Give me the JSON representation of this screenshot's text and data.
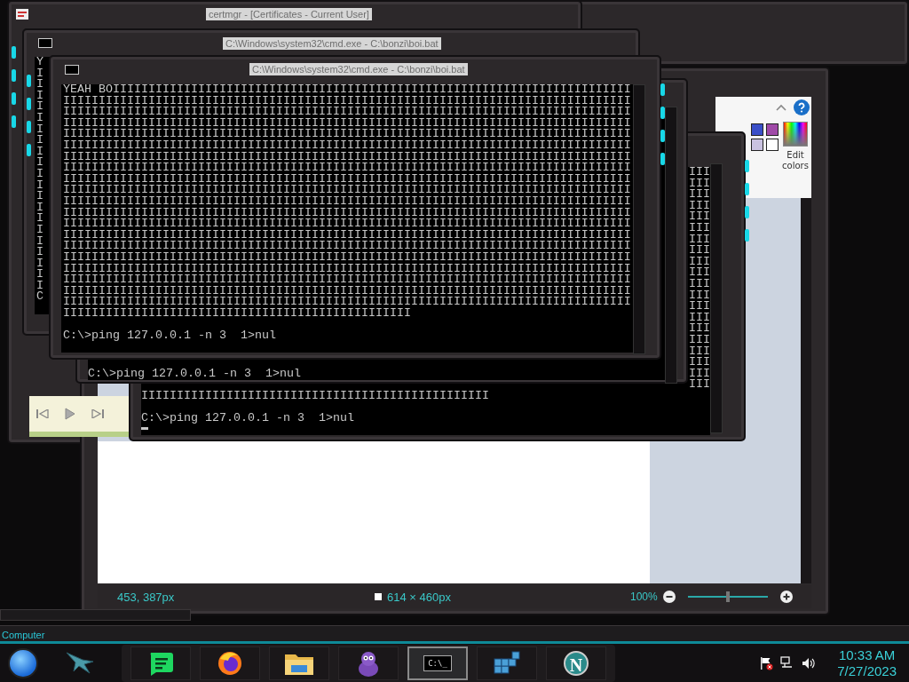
{
  "certmgr_window": {
    "title": "certmgr - [Certificates - Current User]"
  },
  "paint_window": {
    "palette": [
      {
        "color": "#3a4fc8"
      },
      {
        "color": "#a04aa8"
      },
      {
        "color": "#c9c2e0"
      },
      {
        "color": "#ffffff"
      }
    ],
    "edit_colors": "Edit colors",
    "cursor_position": "453, 387px",
    "canvas_size": "614 × 460px",
    "zoom": "100%",
    "zoom_slider": {
      "level": 0.5
    }
  },
  "cmd_windows": [
    {
      "title": "C:\\Windows\\system32\\cmd.exe - C:\\bonzi\\boi.bat",
      "lines": [
        "Y",
        "I",
        "I",
        "I",
        "I",
        "I",
        "I",
        "I",
        "I",
        "I",
        "I",
        "I",
        "I",
        "I",
        "I",
        "I",
        "I",
        "I",
        "I",
        "I",
        "I",
        "C"
      ]
    },
    {
      "prompt": "C:\\>ping 127.0.0.1 -n 3  1>nul"
    },
    {
      "right_lines": [
        "III",
        "III",
        "III",
        "III",
        "III",
        "III",
        "III",
        "III",
        "III",
        "III",
        "III",
        "III",
        "III",
        "III",
        "III",
        "III",
        "III",
        "III",
        "III",
        "III"
      ],
      "lines": [
        "IIIIIIIIIIIIIIIIIIIIIIIIIIIIIIIIIIIIIIIIIIIIIIIII"
      ],
      "prompt": "C:\\>ping 127.0.0.1 -n 3  1>nul"
    },
    {
      "title": "C:\\Windows\\system32\\cmd.exe - C:\\bonzi\\boi.bat",
      "lines": [
        "YEAH BOIIIIIIIIIIIIIIIIIIIIIIIIIIIIIIIIIIIIIIIIIIIIIIIIIIIIIIIIIIIIIIIIIIIIIIIII",
        "IIIIIIIIIIIIIIIIIIIIIIIIIIIIIIIIIIIIIIIIIIIIIIIIIIIIIIIIIIIIIIIIIIIIIIIIIIIIIIII",
        "IIIIIIIIIIIIIIIIIIIIIIIIIIIIIIIIIIIIIIIIIIIIIIIIIIIIIIIIIIIIIIIIIIIIIIIIIIIIIIII",
        "IIIIIIIIIIIIIIIIIIIIIIIIIIIIIIIIIIIIIIIIIIIIIIIIIIIIIIIIIIIIIIIIIIIIIIIIIIIIIIII",
        "IIIIIIIIIIIIIIIIIIIIIIIIIIIIIIIIIIIIIIIIIIIIIIIIIIIIIIIIIIIIIIIIIIIIIIIIIIIIIIII",
        "IIIIIIIIIIIIIIIIIIIIIIIIIIIIIIIIIIIIIIIIIIIIIIIIIIIIIIIIIIIIIIIIIIIIIIIIIIIIIIII",
        "IIIIIIIIIIIIIIIIIIIIIIIIIIIIIIIIIIIIIIIIIIIIIIIIIIIIIIIIIIIIIIIIIIIIIIIIIIIIIIII",
        "IIIIIIIIIIIIIIIIIIIIIIIIIIIIIIIIIIIIIIIIIIIIIIIIIIIIIIIIIIIIIIIIIIIIIIIIIIIIIIII",
        "IIIIIIIIIIIIIIIIIIIIIIIIIIIIIIIIIIIIIIIIIIIIIIIIIIIIIIIIIIIIIIIIIIIIIIIIIIIIIIII",
        "IIIIIIIIIIIIIIIIIIIIIIIIIIIIIIIIIIIIIIIIIIIIIIIIIIIIIIIIIIIIIIIIIIIIIIIIIIIIIIII",
        "IIIIIIIIIIIIIIIIIIIIIIIIIIIIIIIIIIIIIIIIIIIIIIIIIIIIIIIIIIIIIIIIIIIIIIIIIIIIIIII",
        "IIIIIIIIIIIIIIIIIIIIIIIIIIIIIIIIIIIIIIIIIIIIIIIIIIIIIIIIIIIIIIIIIIIIIIIIIIIIIIII",
        "IIIIIIIIIIIIIIIIIIIIIIIIIIIIIIIIIIIIIIIIIIIIIIIIIIIIIIIIIIIIIIIIIIIIIIIIIIIIIIII",
        "IIIIIIIIIIIIIIIIIIIIIIIIIIIIIIIIIIIIIIIIIIIIIIIIIIIIIIIIIIIIIIIIIIIIIIIIIIIIIIII",
        "IIIIIIIIIIIIIIIIIIIIIIIIIIIIIIIIIIIIIIIIIIIIIIIIIIIIIIIIIIIIIIIIIIIIIIIIIIIIIIII",
        "IIIIIIIIIIIIIIIIIIIIIIIIIIIIIIIIIIIIIIIIIIIIIIIIIIIIIIIIIIIIIIIIIIIIIIIIIIIIIIII",
        "IIIIIIIIIIIIIIIIIIIIIIIIIIIIIIIIIIIIIIIIIIIIIIIIIIIIIIIIIIIIIIIIIIIIIIIIIIIIIIII",
        "IIIIIIIIIIIIIIIIIIIIIIIIIIIIIIIIIIIIIIIIIIIIIIIIIIIIIIIIIIIIIIIIIIIIIIIIIIIIIIII",
        "IIIIIIIIIIIIIIIIIIIIIIIIIIIIIIIIIIIIIIIIIIIIIIIIIIIIIIIIIIIIIIIIIIIIIIIIIIIIIIII",
        "IIIIIIIIIIIIIIIIIIIIIIIIIIIIIIIIIIIIIIIIIIIIIIIIIIIIIIIIIIIIIIIIIIIIIIIIIIIIIIII",
        "IIIIIIIIIIIIIIIIIIIIIIIIIIIIIIIIIIIIIIIIIIIIIIIII"
      ],
      "prompt": "C:\\>ping 127.0.0.1 -n 3  1>nul"
    }
  ],
  "desktop": {
    "label": "Computer"
  },
  "taskbar": {
    "items": [
      {
        "kind": "chat",
        "selected": false
      },
      {
        "kind": "browser",
        "selected": false
      },
      {
        "kind": "folder",
        "selected": false
      },
      {
        "kind": "creature",
        "selected": false
      },
      {
        "kind": "terminal",
        "glyph": "C:\\_",
        "selected": true
      },
      {
        "kind": "cubes",
        "selected": false
      },
      {
        "kind": "letter",
        "glyph": "N",
        "selected": false
      }
    ],
    "time": "10:33 AM",
    "date": "7/27/2023"
  }
}
